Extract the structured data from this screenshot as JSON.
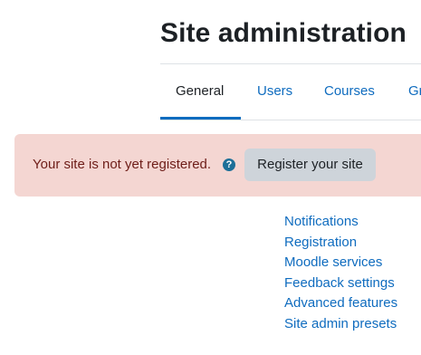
{
  "page": {
    "title": "Site administration"
  },
  "tabs": [
    {
      "label": "General",
      "active": true
    },
    {
      "label": "Users",
      "active": false
    },
    {
      "label": "Courses",
      "active": false
    },
    {
      "label": "Gr",
      "active": false
    }
  ],
  "alert": {
    "message": "Your site is not yet registered.",
    "help_icon": "question-circle-icon",
    "help_glyph": "?",
    "button_label": "Register your site"
  },
  "links": [
    "Notifications",
    "Registration",
    "Moodle services",
    "Feedback settings",
    "Advanced features",
    "Site admin presets"
  ],
  "colors": {
    "link": "#0f6cbf",
    "alert_background": "#f4d6d2",
    "alert_text": "#6e1d18",
    "button_background": "#ced4da",
    "active_tab_underline": "#0f6cbf"
  }
}
